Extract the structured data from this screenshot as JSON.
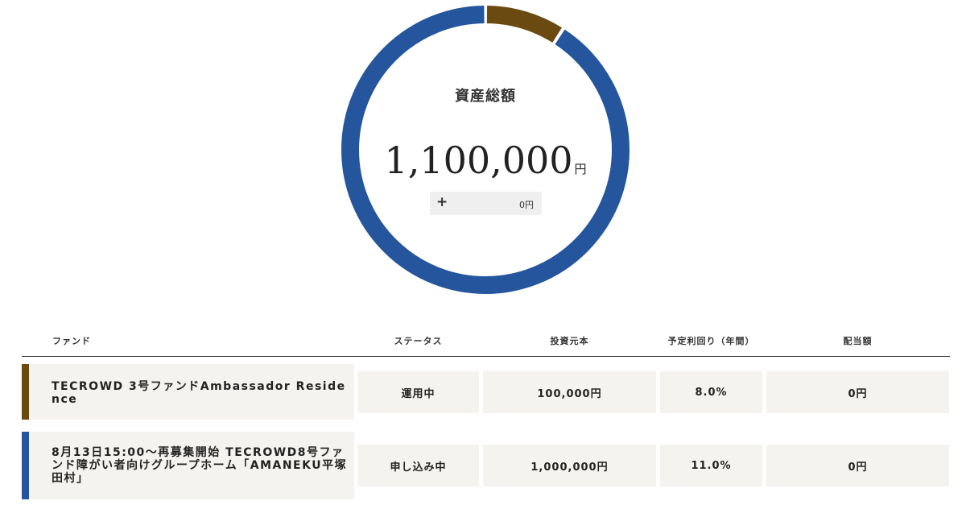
{
  "summary": {
    "title": "資産総額",
    "total_amount": "1,100,000",
    "total_unit": "円",
    "delta_sign": "+",
    "delta_value": "0円"
  },
  "allocation": {
    "segments": [
      {
        "fund": "TECROWD 3号ファンドAmbassador Residence",
        "amount": 100000,
        "color": "#6b4a12"
      },
      {
        "fund": "8月13日15:00〜再募集開始 TECROWD8号ファンド障がい者向けグループホーム「AMANEKU平塚田村」",
        "amount": 1000000,
        "color": "#25559c"
      }
    ]
  },
  "table": {
    "headers": {
      "fund": "ファンド",
      "status": "ステータス",
      "principal": "投資元本",
      "yield": "予定利回り（年間）",
      "dividend": "配当額"
    },
    "rows": [
      {
        "fund": "TECROWD 3号ファンドAmbassador Residence",
        "status": "運用中",
        "principal": "100,000円",
        "yield": "8.0%",
        "dividend": "0円",
        "color": "#6b4a12"
      },
      {
        "fund": "8月13日15:00〜再募集開始 TECROWD8号ファンド障がい者向けグループホーム「AMANEKU平塚田村」",
        "status": "申し込み中",
        "principal": "1,000,000円",
        "yield": "11.0%",
        "dividend": "0円",
        "color": "#25559c"
      }
    ]
  }
}
